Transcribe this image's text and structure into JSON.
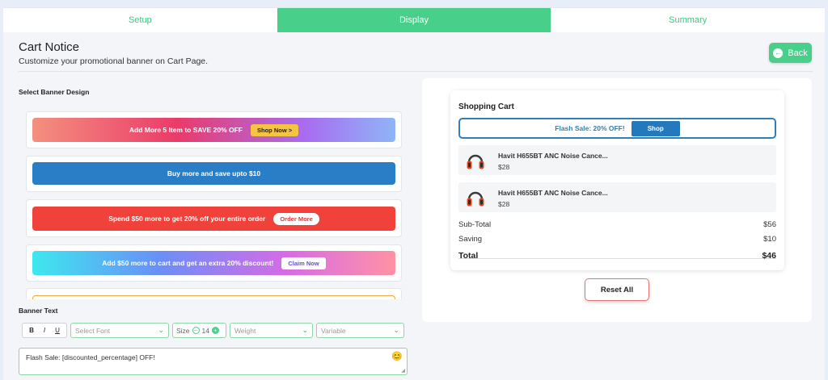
{
  "tabs": [
    {
      "label": "Setup",
      "active": false
    },
    {
      "label": "Display",
      "active": true
    },
    {
      "label": "Summary",
      "active": false
    }
  ],
  "header": {
    "title": "Cart Notice",
    "subtitle": "Customize your promotional banner on Cart Page.",
    "back_label": "Back"
  },
  "design_section": {
    "label": "Select Banner Design",
    "banners": [
      {
        "text": "Add More 5 Item to SAVE 20% OFF",
        "button": "Shop Now >"
      },
      {
        "text": "Buy more and save upto $10",
        "button": ""
      },
      {
        "text": "Spend $50 more to get 20% off your entire order",
        "button": "Order More"
      },
      {
        "text": "Add $50 more to cart and get an extra 20% discount!",
        "button": "Claim Now"
      }
    ]
  },
  "banner_text": {
    "label": "Banner Text",
    "bold": "B",
    "italic": "I",
    "underline": "U",
    "font_placeholder": "Select Font",
    "size_label": "Size",
    "size_value": "14",
    "weight_placeholder": "Weight",
    "variable_placeholder": "Variable",
    "value": "Flash Sale: [discounted_percentage] OFF!"
  },
  "preview": {
    "title": "Shopping Cart",
    "banner_text": "Flash Sale: 20% OFF!",
    "banner_button": "Shop",
    "items": [
      {
        "name": "Havit H655BT ANC Noise Cance...",
        "price": "$28"
      },
      {
        "name": "Havit H655BT ANC Noise Cance...",
        "price": "$28"
      }
    ],
    "subtotal_label": "Sub-Total",
    "subtotal_value": "$56",
    "saving_label": "Saving",
    "saving_value": "$10",
    "total_label": "Total",
    "total_value": "$46"
  },
  "reset_label": "Reset All",
  "colors": {
    "accent_green": "#48cf8a",
    "preview_blue": "#2f7fb8",
    "reset_border": "#e57373"
  }
}
